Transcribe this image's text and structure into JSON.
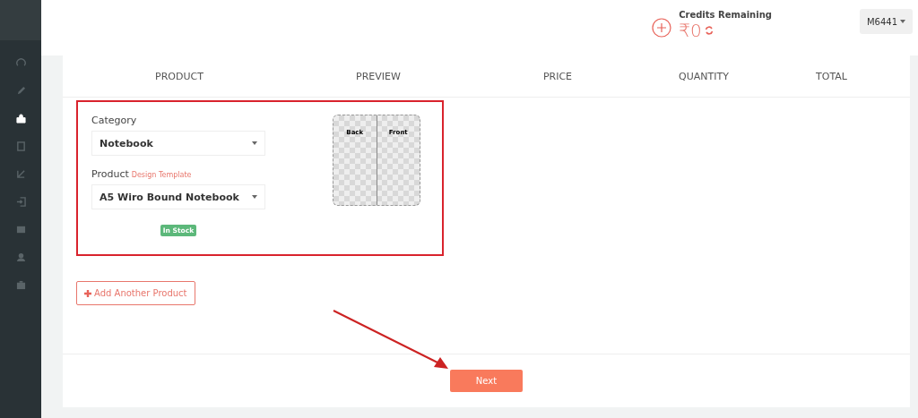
{
  "sidebar": {
    "items": [
      {
        "selected": false
      },
      {
        "selected": false
      },
      {
        "selected": true
      },
      {
        "selected": false
      },
      {
        "selected": false
      },
      {
        "selected": false
      },
      {
        "selected": false
      },
      {
        "selected": false
      },
      {
        "selected": false
      }
    ]
  },
  "header": {
    "credits_label": "Credits Remaining",
    "credits_value": "₹0",
    "account_button": "M6441"
  },
  "table": {
    "columns": [
      "PRODUCT",
      "PREVIEW",
      "PRICE",
      "QUANTITY",
      "TOTAL"
    ]
  },
  "product_form": {
    "category_label": "Category",
    "category_value": "Notebook",
    "product_label": "Product",
    "design_template_link": "Design Template",
    "product_value": "A5 Wiro Bound Notebook",
    "stock_badge": "In Stock",
    "preview_labels": [
      "Back",
      "Front"
    ]
  },
  "add_button": "Add Another Product",
  "next_button": "Next"
}
